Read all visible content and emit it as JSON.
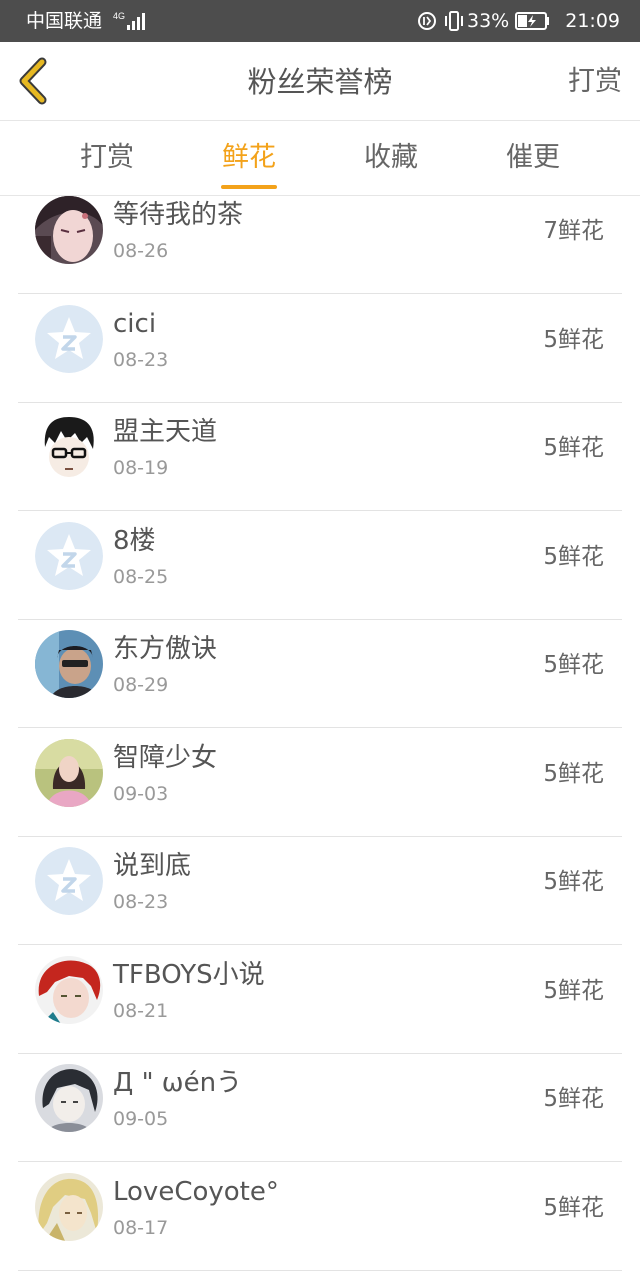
{
  "status_bar": {
    "carrier": "中国联通",
    "network": "4G",
    "battery": "33%",
    "time": "21:09"
  },
  "header": {
    "title": "粉丝荣誉榜",
    "action": "打赏",
    "back_icon": "chevron-left-icon"
  },
  "tabs": [
    {
      "label": "打赏",
      "active": false
    },
    {
      "label": "鲜花",
      "active": true
    },
    {
      "label": "收藏",
      "active": false
    },
    {
      "label": "催更",
      "active": false
    }
  ],
  "colors": {
    "accent": "#f3a21a",
    "status_bar": "#4d4d4d",
    "back_icon": "#e6b822"
  },
  "fans": [
    {
      "name": "等待我的茶",
      "date": "08-26",
      "count": "7鲜花",
      "avatar": "anime-portrait"
    },
    {
      "name": "cici",
      "date": "08-23",
      "count": "5鲜花",
      "avatar": "default-avatar"
    },
    {
      "name": "盟主天道",
      "date": "08-19",
      "count": "5鲜花",
      "avatar": "cartoon-glasses"
    },
    {
      "name": "8楼",
      "date": "08-25",
      "count": "5鲜花",
      "avatar": "default-avatar"
    },
    {
      "name": "东方傲诀",
      "date": "08-29",
      "count": "5鲜花",
      "avatar": "photo-man"
    },
    {
      "name": "智障少女",
      "date": "09-03",
      "count": "5鲜花",
      "avatar": "photo-girl"
    },
    {
      "name": "说到底",
      "date": "08-23",
      "count": "5鲜花",
      "avatar": "default-avatar"
    },
    {
      "name": "TFBOYS小说",
      "date": "08-21",
      "count": "5鲜花",
      "avatar": "photo-redhair"
    },
    {
      "name": "Д \" ωénう",
      "date": "09-05",
      "count": "5鲜花",
      "avatar": "photo-bw"
    },
    {
      "name": "LoveCoyote°",
      "date": "08-17",
      "count": "5鲜花",
      "avatar": "anime-blonde"
    }
  ]
}
